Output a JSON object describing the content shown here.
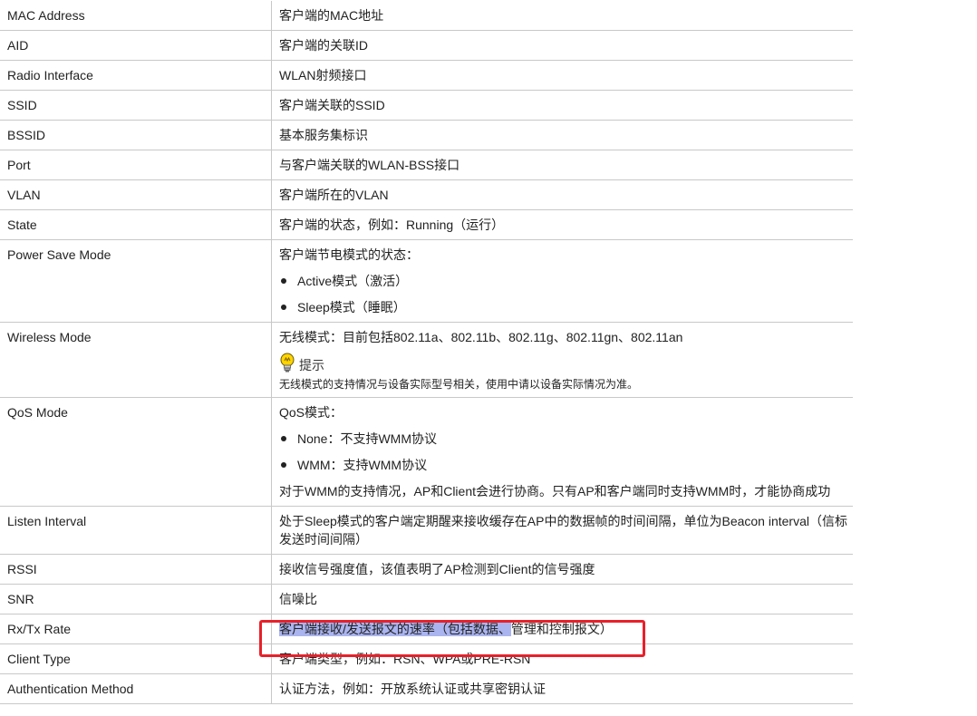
{
  "rows": {
    "mac": {
      "name": "MAC Address",
      "desc": "客户端的MAC地址"
    },
    "aid": {
      "name": "AID",
      "desc": "客户端的关联ID"
    },
    "radio": {
      "name": "Radio Interface",
      "desc": "WLAN射频接口"
    },
    "ssid": {
      "name": "SSID",
      "desc": "客户端关联的SSID"
    },
    "bssid": {
      "name": "BSSID",
      "desc": "基本服务集标识"
    },
    "port": {
      "name": "Port",
      "desc": "与客户端关联的WLAN-BSS接口"
    },
    "vlan": {
      "name": "VLAN",
      "desc": "客户端所在的VLAN"
    },
    "state": {
      "name": "State",
      "desc": "客户端的状态，例如：Running（运行）"
    },
    "psm": {
      "name": "Power Save Mode",
      "intro": "客户端节电模式的状态：",
      "bullets": [
        "Active模式（激活）",
        "Sleep模式（睡眠）"
      ]
    },
    "wireless": {
      "name": "Wireless Mode",
      "desc": "无线模式：目前包括802.11a、802.11b、802.11g、802.11gn、802.11an",
      "note_title": "提示",
      "note_text": "无线模式的支持情况与设备实际型号相关，使用中请以设备实际情况为准。"
    },
    "qos": {
      "name": "QoS Mode",
      "intro": "QoS模式：",
      "bullets": [
        "None：不支持WMM协议",
        "WMM：支持WMM协议"
      ],
      "extra": "对于WMM的支持情况，AP和Client会进行协商。只有AP和客户端同时支持WMM时，才能协商成功"
    },
    "listen": {
      "name": "Listen Interval",
      "desc": "处于Sleep模式的客户端定期醒来接收缓存在AP中的数据帧的时间间隔，单位为Beacon interval（信标发送时间间隔）"
    },
    "rssi": {
      "name": "RSSI",
      "desc": "接收信号强度值，该值表明了AP检测到Client的信号强度"
    },
    "snr": {
      "name": "SNR",
      "desc": "信噪比"
    },
    "rate": {
      "name": "Rx/Tx Rate",
      "desc_highlighted": "客户端接收/发送报文的速率（包括数据、",
      "desc_rest": "管理和控制报文）"
    },
    "ctype": {
      "name": "Client Type",
      "desc": "客户端类型，例如：RSN、WPA或PRE-RSN"
    },
    "auth": {
      "name": "Authentication Method",
      "desc": "认证方法，例如：开放系统认证或共享密钥认证"
    }
  },
  "colors": {
    "highlight": "#aab4ee",
    "annotation_box": "#e8202a",
    "border": "#c8c8c8"
  },
  "icons": {
    "note": "lightbulb-icon"
  }
}
